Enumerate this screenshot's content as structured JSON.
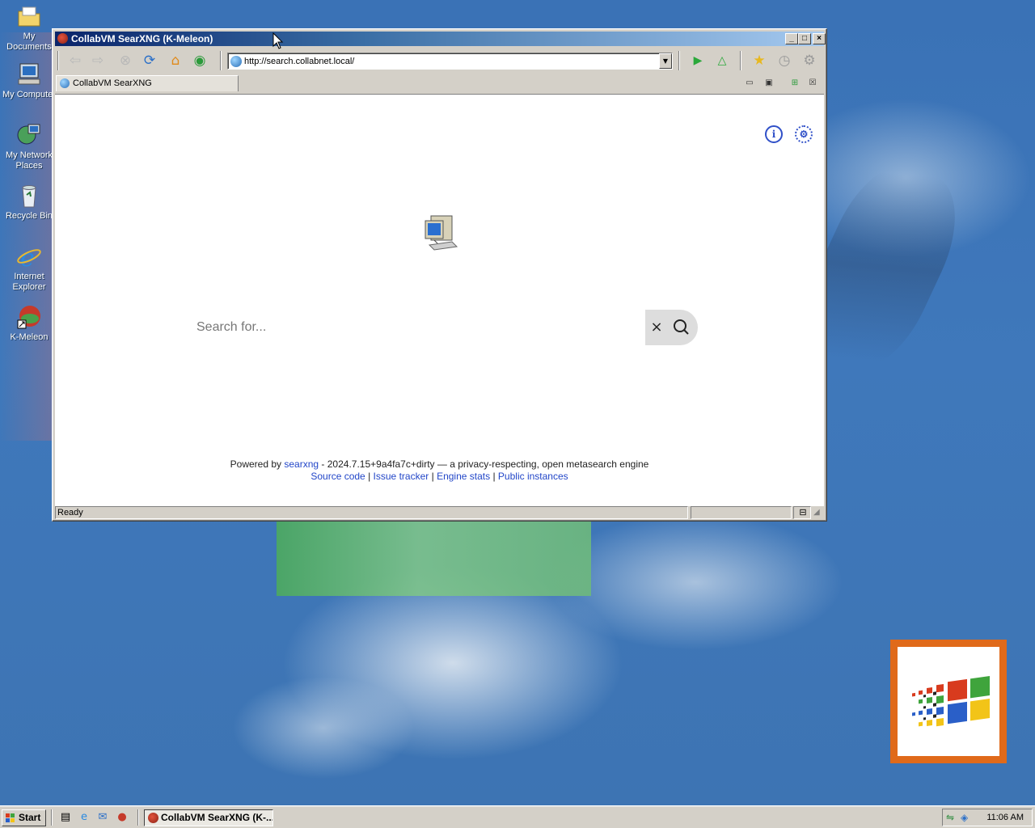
{
  "desktop": {
    "icons": [
      {
        "label": "My Documents"
      },
      {
        "label": "My Computer"
      },
      {
        "label": "My Network Places"
      },
      {
        "label": "Recycle Bin"
      },
      {
        "label": "Internet Explorer"
      },
      {
        "label": "K-Meleon"
      }
    ]
  },
  "window": {
    "title": "CollabVM SearXNG (K-Meleon)",
    "controls": {
      "minimize": "_",
      "maximize": "□",
      "close": "×"
    }
  },
  "toolbar": {
    "buttons": [
      {
        "name": "back",
        "icon": "back-arrow-icon"
      },
      {
        "name": "forward",
        "icon": "forward-arrow-icon"
      },
      {
        "name": "stop",
        "icon": "stop-icon"
      },
      {
        "name": "reload",
        "icon": "reload-icon"
      },
      {
        "name": "home",
        "icon": "home-icon"
      },
      {
        "name": "search",
        "icon": "globe-icon"
      },
      {
        "name": "go",
        "icon": "play-icon"
      },
      {
        "name": "up",
        "icon": "up-icon"
      },
      {
        "name": "bookmarks",
        "icon": "star-icon"
      },
      {
        "name": "history",
        "icon": "clock-icon"
      },
      {
        "name": "preferences",
        "icon": "gear-icon"
      }
    ],
    "url": "http://search.collabnet.local/"
  },
  "tabs": [
    {
      "label": "CollabVM SearXNG",
      "active": true
    }
  ],
  "page": {
    "search": {
      "placeholder": "Search for...",
      "clear_label": "×"
    },
    "footer": {
      "powered_by": "Powered by",
      "searxng_link": "searxng",
      "version_text": "- 2024.7.15+9a4fa7c+dirty — a privacy-respecting, open metasearch engine",
      "links": [
        "Source code",
        "Issue tracker",
        "Engine stats",
        "Public instances"
      ],
      "separator": "|"
    }
  },
  "statusbar": {
    "text": "Ready"
  },
  "taskbar": {
    "start_label": "Start",
    "task_label": "CollabVM SearXNG (K-...",
    "clock": "11:06 AM"
  },
  "colors": {
    "titlebar_start": "#0a246a",
    "titlebar_end": "#a6caf0",
    "link": "#2246c8",
    "desktop": "#3a6ea5",
    "chrome": "#d4d0c8"
  }
}
